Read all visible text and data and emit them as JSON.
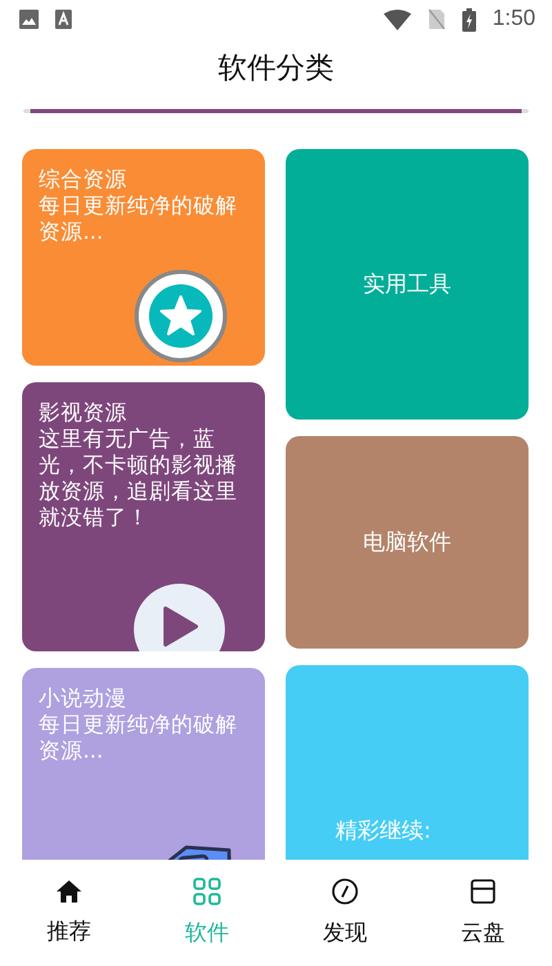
{
  "status_bar": {
    "time": "1:50"
  },
  "header": {
    "title": "软件分类"
  },
  "left_cards": [
    {
      "title": "综合资源",
      "description": "每日更新纯净的破解资源...",
      "color": "#f98c35"
    },
    {
      "title": "影视资源",
      "description": "这里有无广告，蓝光，不卡顿的影视播放资源，追剧看这里就没错了！",
      "color": "#7e477c"
    },
    {
      "title": "小说动漫",
      "description": "每日更新纯净的破解资源...",
      "color": "#afa0e0"
    }
  ],
  "right_cards": [
    {
      "title": "实用工具",
      "color": "#03ae98"
    },
    {
      "title": "电脑软件",
      "color": "#b3846a"
    },
    {
      "title": "精彩继续:",
      "color": "#45cdf5"
    }
  ],
  "bottom_nav": [
    {
      "label": "推荐",
      "selected": false
    },
    {
      "label": "软件",
      "selected": true
    },
    {
      "label": "发现",
      "selected": false
    },
    {
      "label": "云盘",
      "selected": false
    }
  ]
}
